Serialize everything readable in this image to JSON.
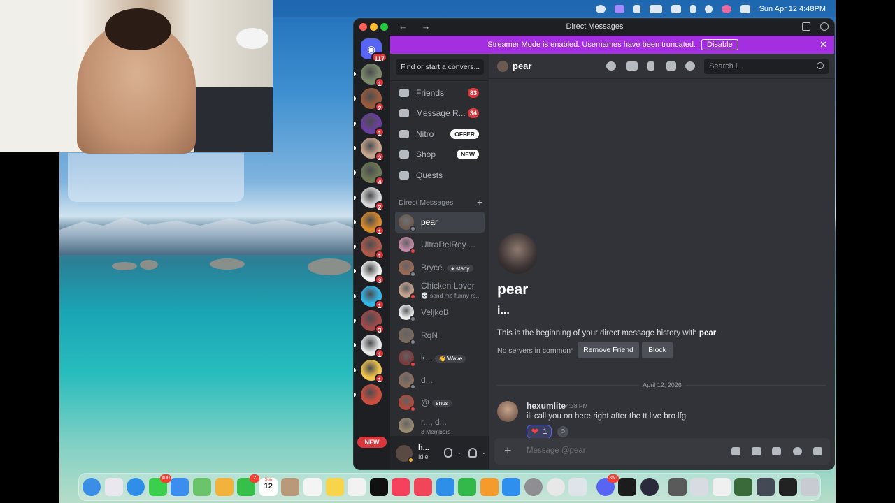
{
  "menubar": {
    "datetime": "Sun Apr 12  4:48PM"
  },
  "window": {
    "title": "Direct Messages",
    "nav_arrows": "← →"
  },
  "rail": {
    "home_badge": "117",
    "new_label": "NEW",
    "servers": [
      {
        "badge": "1",
        "color": "#7d8a6a"
      },
      {
        "badge": "2",
        "color": "#9a5b3c"
      },
      {
        "badge": "1",
        "color": "#6b3fa0"
      },
      {
        "badge": "2",
        "color": "#c9a58e"
      },
      {
        "badge": "4",
        "color": "#6e7a55"
      },
      {
        "badge": "2",
        "color": "#d8d8d8"
      },
      {
        "badge": "1",
        "color": "#d98a2b"
      },
      {
        "badge": "1",
        "color": "#b05a4a"
      },
      {
        "badge": "3",
        "color": "#f2f2f2"
      },
      {
        "badge": "1",
        "color": "#35b7e8"
      },
      {
        "badge": "3",
        "color": "#a34a4a"
      },
      {
        "badge": "1",
        "color": "#e8e8e8"
      },
      {
        "badge": "1",
        "color": "#f3c64b"
      },
      {
        "badge": "",
        "color": "#cc4e3f"
      }
    ]
  },
  "banner": {
    "text": "Streamer Mode is enabled. Usernames have been truncated.",
    "button": "Disable",
    "close": "✕"
  },
  "sidebar": {
    "search_placeholder": "Find or start a convers...",
    "nav": [
      {
        "label": "Friends",
        "count": "83",
        "tag": "",
        "icon": "friends-icon"
      },
      {
        "label": "Message R...",
        "count": "34",
        "tag": "",
        "icon": "message-requests-icon"
      },
      {
        "label": "Nitro",
        "count": "",
        "tag": "OFFER",
        "icon": "nitro-icon"
      },
      {
        "label": "Shop",
        "count": "",
        "tag": "NEW",
        "icon": "shop-icon"
      },
      {
        "label": "Quests",
        "count": "",
        "tag": "",
        "icon": "quests-icon"
      }
    ],
    "dm_header": "Direct Messages",
    "dm_add": "+",
    "dms": [
      {
        "name": "pear",
        "sub": "",
        "tag": "",
        "status": "#80848e",
        "color": "#6b5a50"
      },
      {
        "name": "UltraDelRey ...",
        "sub": "",
        "tag": "",
        "status": "#f23f43",
        "color": "#c58aa8"
      },
      {
        "name": "Bryce.",
        "sub": "",
        "tag": "♦ stacy",
        "status": "#80848e",
        "color": "#9a6a55"
      },
      {
        "name": "Chicken Lover",
        "sub": "💀 send me funny re...",
        "tag": "",
        "status": "#f23f43",
        "color": "#c8a58e"
      },
      {
        "name": "VeljkoB",
        "sub": "",
        "tag": "",
        "status": "#80848e",
        "color": "#eeeeee"
      },
      {
        "name": "RqN",
        "sub": "",
        "tag": "",
        "status": "#80848e",
        "color": "#7a6a5e"
      },
      {
        "name": "k...",
        "sub": "",
        "tag": "👋 Wave",
        "status": "#f23f43",
        "color": "#7a3b3b"
      },
      {
        "name": "d...",
        "sub": "",
        "tag": "",
        "status": "#80848e",
        "color": "#8b6f5e"
      },
      {
        "name": "@",
        "sub": "",
        "tag": "snus",
        "status": "#f23f43",
        "color": "#b04a3a"
      },
      {
        "name": "r..., d...",
        "sub": "3 Members",
        "tag": "",
        "status": "",
        "color": "#9a8a70"
      }
    ]
  },
  "user": {
    "name": "h...",
    "status": "Idle"
  },
  "chat": {
    "channel_name": "pear",
    "search_placeholder": "Search i...",
    "profile_name": "pear",
    "profile_username": "i...",
    "beginning_prefix": "This is the beginning of your direct message history with ",
    "beginning_name": "pear",
    "beginning_suffix": ".",
    "no_servers": "No servers in common",
    "separator": "•",
    "remove_friend": "Remove Friend",
    "block": "Block",
    "date_divider": "April 12, 2026",
    "message": {
      "author": "hexumlite",
      "time": "4:38 PM",
      "text": "ill call you on here right after the tt live bro lfg",
      "reaction_emoji": "❤",
      "reaction_count": "1"
    },
    "composer_placeholder": "Message @pear",
    "composer_plus": "+"
  },
  "dock": {
    "apps": [
      {
        "name": "finder",
        "color": "#3a8ee6",
        "badge": ""
      },
      {
        "name": "launchpad",
        "color": "#e8e8ee",
        "badge": ""
      },
      {
        "name": "safari",
        "color": "#2f8fe8",
        "badge": ""
      },
      {
        "name": "messages",
        "color": "#3ccf4e",
        "badge": "400"
      },
      {
        "name": "mail",
        "color": "#3b8df0",
        "badge": ""
      },
      {
        "name": "maps",
        "color": "#6cc46a",
        "badge": ""
      },
      {
        "name": "photos",
        "color": "#f3b23a",
        "badge": ""
      },
      {
        "name": "facetime",
        "color": "#36c04a",
        "badge": "2"
      },
      {
        "name": "calendar",
        "color": "#ffffff",
        "badge": ""
      },
      {
        "name": "contacts",
        "color": "#b89a7a",
        "badge": ""
      },
      {
        "name": "reminders",
        "color": "#f4f4f4",
        "badge": ""
      },
      {
        "name": "notes",
        "color": "#f7d44a",
        "badge": ""
      },
      {
        "name": "freeform",
        "color": "#f2f2f2",
        "badge": ""
      },
      {
        "name": "apple-tv",
        "color": "#111111",
        "badge": ""
      },
      {
        "name": "music",
        "color": "#f6405c",
        "badge": ""
      },
      {
        "name": "news",
        "color": "#f1455a",
        "badge": ""
      },
      {
        "name": "keynote",
        "color": "#2d8fe8",
        "badge": ""
      },
      {
        "name": "numbers",
        "color": "#35b84a",
        "badge": ""
      },
      {
        "name": "pages",
        "color": "#f49b2b",
        "badge": ""
      },
      {
        "name": "app-store",
        "color": "#2f8fef",
        "badge": ""
      },
      {
        "name": "system-settings",
        "color": "#8e8e93",
        "badge": ""
      },
      {
        "name": "chrome",
        "color": "#e8e8e8",
        "badge": ""
      },
      {
        "name": "iphone-mirroring",
        "color": "#dfe3ea",
        "badge": ""
      },
      {
        "name": "discord",
        "color": "#5865f2",
        "badge": "350"
      },
      {
        "name": "spotify",
        "color": "#1c1c1c",
        "badge": ""
      },
      {
        "name": "obs",
        "color": "#2a2a3a",
        "badge": ""
      },
      {
        "name": "preview-1",
        "color": "#5a5a5a",
        "badge": ""
      },
      {
        "name": "preview-2",
        "color": "#d8dce2",
        "badge": ""
      },
      {
        "name": "preview-3",
        "color": "#f0f0f0",
        "badge": ""
      },
      {
        "name": "preview-4",
        "color": "#3a6a3a",
        "badge": ""
      },
      {
        "name": "preview-5",
        "color": "#444a55",
        "badge": ""
      },
      {
        "name": "preview-6",
        "color": "#222222",
        "badge": ""
      },
      {
        "name": "trash",
        "color": "#c8ccd2",
        "badge": ""
      }
    ],
    "calendar_month": "Sun",
    "calendar_day": "12"
  },
  "colors": {
    "accent": "#5865f2",
    "banner": "#a32fe0",
    "danger": "#da373c"
  }
}
